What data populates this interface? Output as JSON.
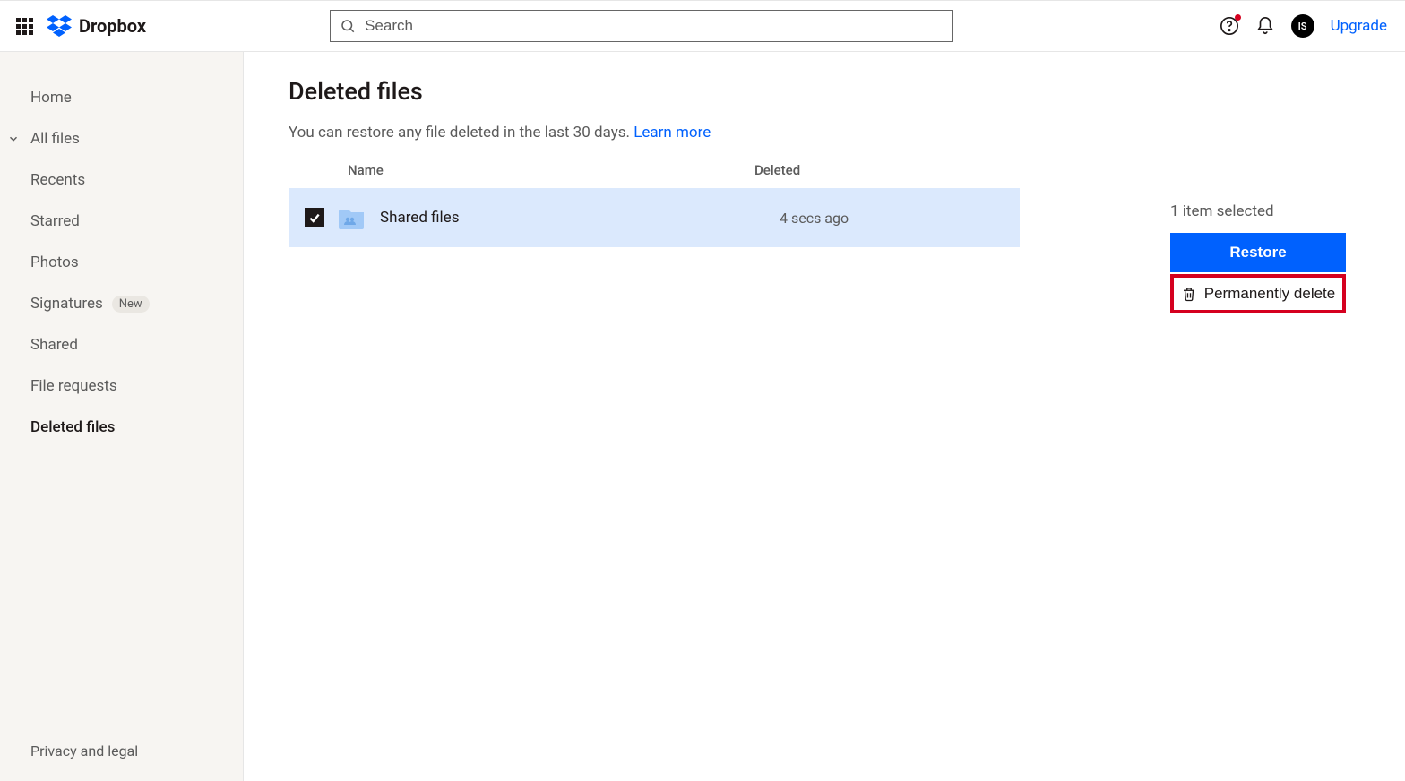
{
  "header": {
    "brand": "Dropbox",
    "search_placeholder": "Search",
    "upgrade": "Upgrade",
    "avatar_initials": "IS"
  },
  "sidebar": {
    "items": [
      {
        "label": "Home",
        "expandable": false,
        "active": false
      },
      {
        "label": "All files",
        "expandable": true,
        "active": false
      },
      {
        "label": "Recents",
        "expandable": false,
        "active": false
      },
      {
        "label": "Starred",
        "expandable": false,
        "active": false
      },
      {
        "label": "Photos",
        "expandable": false,
        "active": false
      },
      {
        "label": "Signatures",
        "expandable": false,
        "active": false,
        "badge": "New"
      },
      {
        "label": "Shared",
        "expandable": false,
        "active": false
      },
      {
        "label": "File requests",
        "expandable": false,
        "active": false
      },
      {
        "label": "Deleted files",
        "expandable": false,
        "active": true
      }
    ],
    "footer": "Privacy and legal"
  },
  "page": {
    "title": "Deleted files",
    "subtitle_text": "You can restore any file deleted in the last 30 days. ",
    "subtitle_link": "Learn more",
    "columns": {
      "name": "Name",
      "deleted": "Deleted"
    },
    "rows": [
      {
        "name": "Shared files",
        "deleted": "4 secs ago",
        "selected": true
      }
    ]
  },
  "actions": {
    "selection": "1 item selected",
    "restore": "Restore",
    "permanently_delete": "Permanently delete"
  }
}
